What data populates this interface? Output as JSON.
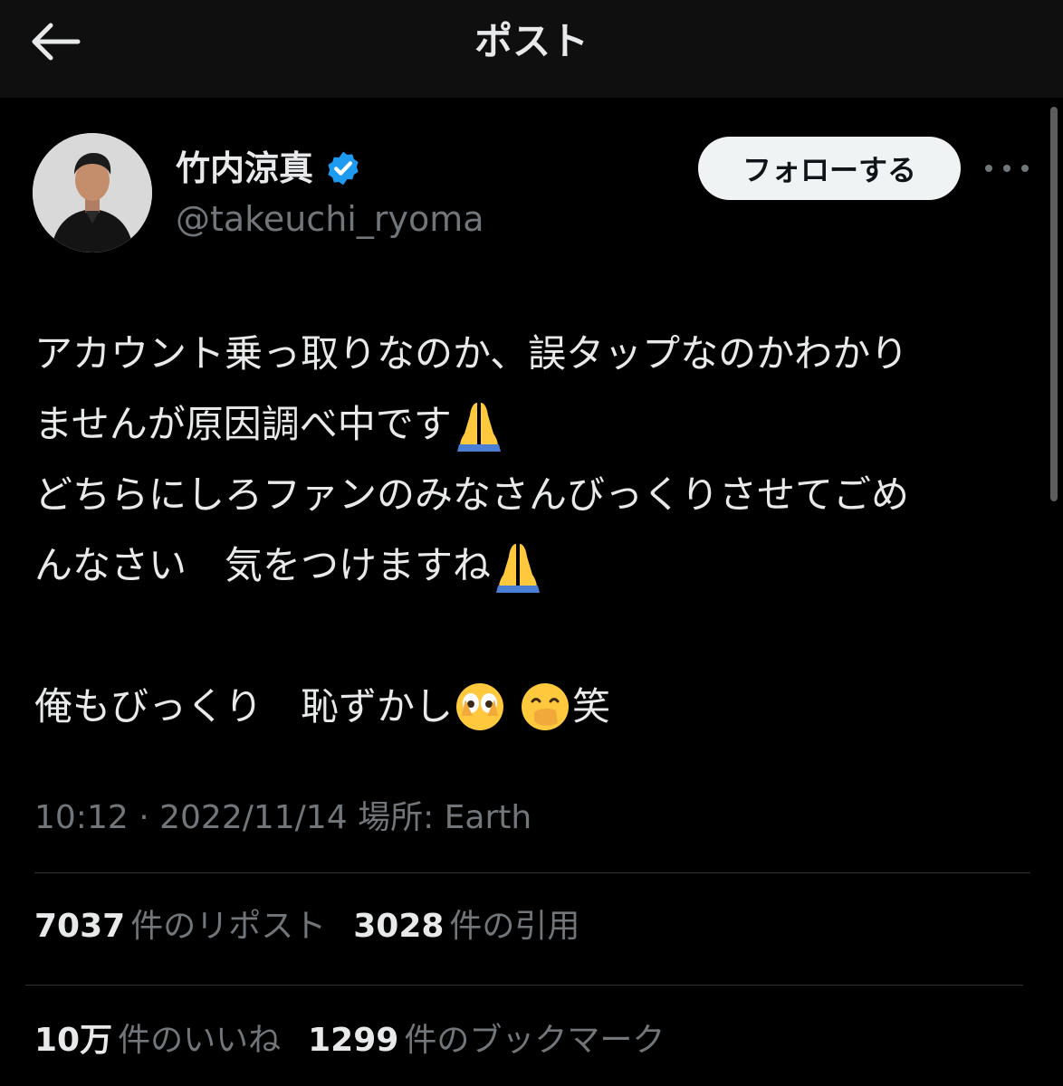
{
  "header": {
    "title": "ポスト",
    "back_icon": "arrow-left-icon"
  },
  "author": {
    "name": "竹内涼真",
    "handle": "@takeuchi_ryoma",
    "verified": true,
    "follow_label": "フォローする"
  },
  "post": {
    "lines": [
      "アカウント乗っ取りなのか、誤タップなのかわかり",
      "ませんが原因調べ中です",
      "どちらにしろファンのみなさんびっくりさせてごめ",
      "んなさい　気をつけますね",
      "",
      "俺もびっくり　恥ずかし",
      "笑"
    ],
    "time": "10:12",
    "separator": "·",
    "date": "2022/11/14",
    "location": "場所: Earth"
  },
  "stats": {
    "reposts_count": "7037",
    "reposts_label": "件のリポスト",
    "quotes_count": "3028",
    "quotes_label": "件の引用",
    "likes_count": "10万",
    "likes_label": "件のいいね",
    "bookmarks_count": "1299",
    "bookmarks_label": "件のブックマーク"
  },
  "colors": {
    "background": "#000000",
    "header_bg": "#0f0f0f",
    "text": "#e7e9ea",
    "muted": "#71767b",
    "verified_blue": "#1d9bf0",
    "follow_bg": "#eff3f4"
  }
}
